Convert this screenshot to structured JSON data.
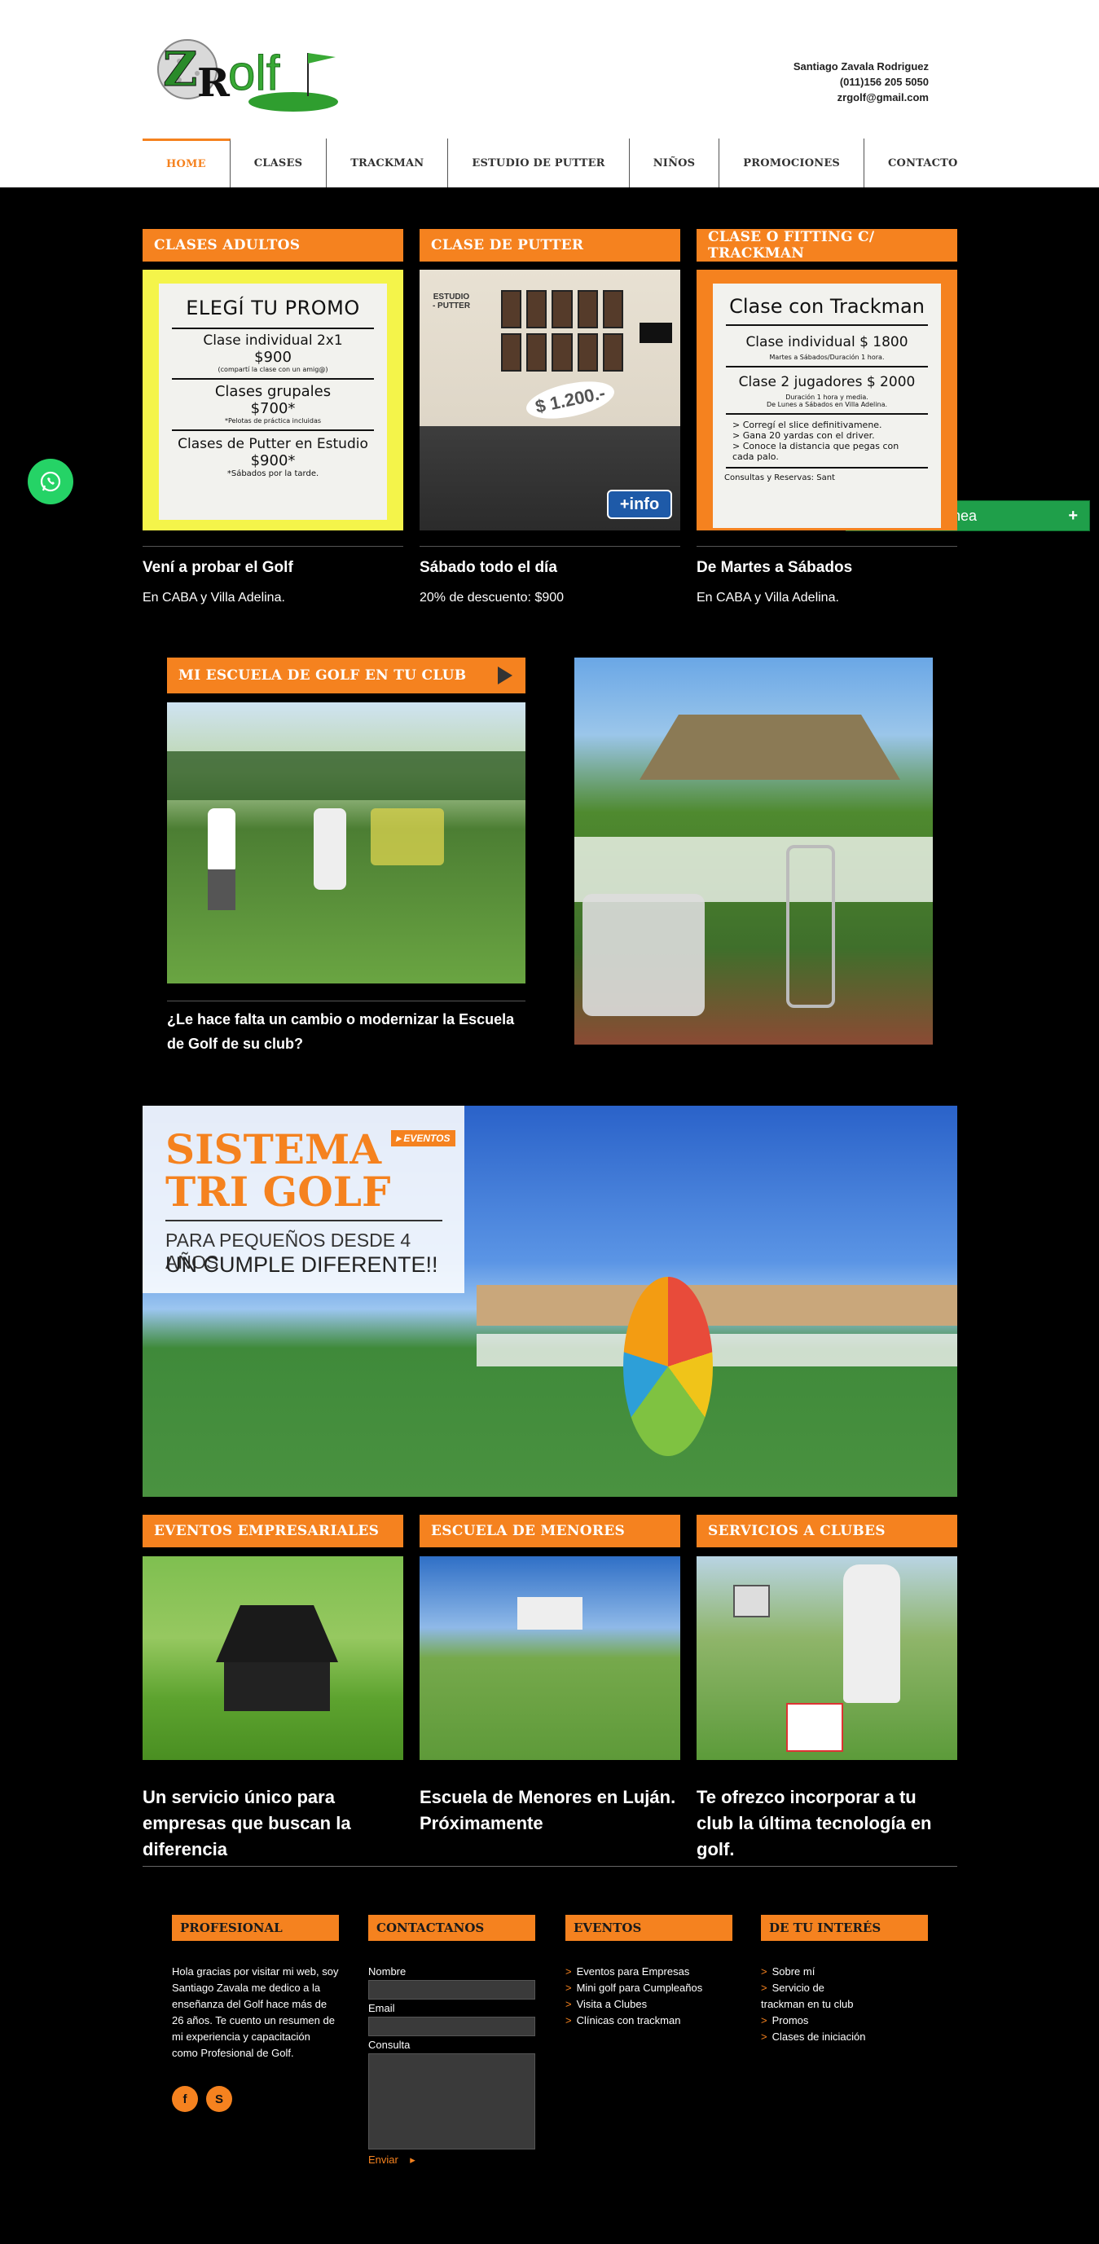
{
  "header": {
    "logo_text": "ZRGolf",
    "contact_name": "Santiago Zavala Rodriguez",
    "contact_phone": "(011)156 205 5050",
    "contact_email": "zrgolf@gmail.com"
  },
  "nav": [
    "HOME",
    "CLASES",
    "TRACKMAN",
    "ESTUDIO DE PUTTER",
    "NIÑOS",
    "PROMOCIONES",
    "CONTACTO"
  ],
  "chat": {
    "label": "ZR Golf - En Línea",
    "toggle": "+"
  },
  "row1": [
    {
      "header": "CLASES ADULTOS",
      "title": "Vení a probar el Golf",
      "sub": "En CABA y Villa Adelina.",
      "promo": {
        "heading": "ELEGÍ TU PROMO",
        "l1": "Clase individual 2x1",
        "l1b": "$900",
        "l1c": "(compartí la clase con un amig@)",
        "l2": "Clases grupales",
        "l2b": "$700*",
        "l2c": "*Pelotas de práctica incluidas",
        "l3": "Clases de Putter en Estudio",
        "l3b": "$900*",
        "l3c": "*Sábados por la tarde."
      }
    },
    {
      "header": "CLASE DE PUTTER",
      "title": "Sábado todo el día",
      "sub": "20% de descuento: $900",
      "img": {
        "price": "$ 1.200.-",
        "sign": "ESTUDIO - PUTTER",
        "info": "+info"
      }
    },
    {
      "header": "CLASE O FITTING C/ TRACKMAN",
      "title": "De Martes a Sábados",
      "sub": "En CABA y Villa Adelina.",
      "promo": {
        "heading": "Clase con Trackman",
        "l1": "Clase individual $ 1800",
        "l1c": "Martes a Sábados/Duración 1 hora.",
        "l2": "Clase 2 jugadores $ 2000",
        "l2c": "Duración 1 hora y media.",
        "l2d": "De Lunes a Sábados en Villa Adelina.",
        "b1": "> Corregí el slice definitivamene.",
        "b2": "> Gana 20 yardas con el driver.",
        "b3": "> Conoce la distancia que pegas con cada palo.",
        "footer": "Consultas y Reservas: Sant"
      }
    }
  ],
  "club_school": {
    "header": "MI ESCUELA DE GOLF EN TU CLUB",
    "text": "¿Le hace falta un cambio o modernizar la Escuela de Golf de su club?"
  },
  "banner": {
    "tag": "EVENTOS",
    "title1": "SISTEMA",
    "title2": "TRI GOLF",
    "sub1": "PARA PEQUEÑOS DESDE 4 AÑOS",
    "sub2": "UN CUMPLE DIFERENTE!!"
  },
  "row2": [
    {
      "header": "EVENTOS EMPRESARIALES",
      "text": "Un servicio único para empresas que buscan la diferencia"
    },
    {
      "header": "ESCUELA DE MENORES",
      "text": "Escuela de Menores en Luján. Próximamente"
    },
    {
      "header": "SERVICIOS A CLUBES",
      "text": "Te ofrezco incorporar a tu club la última tecnología en golf."
    }
  ],
  "footer": {
    "profesional": {
      "title": "PROFESIONAL",
      "text": "Hola gracias por visitar mi web, soy Santiago Zavala me dedico a la enseñanza del Golf hace más de 26 años. Te cuento un resumen de mi experiencia y capacitación como Profesional de Golf."
    },
    "contact": {
      "title": "CONTACTANOS",
      "name_label": "Nombre",
      "email_label": "Email",
      "query_label": "Consulta",
      "send": "Enviar"
    },
    "events": {
      "title": "EVENTOS",
      "links": [
        "Eventos para Empresas",
        "Mini golf para Cumpleaños",
        "Visita a Clubes",
        "Clínicas con trackman"
      ]
    },
    "interest": {
      "title": "DE TU INTERÉS",
      "links": [
        "Sobre mí",
        "Servicio de trackman en tu club",
        "Promos",
        "Clases de iniciación"
      ]
    }
  },
  "colors": {
    "accent": "#f5821f",
    "bg": "#000000",
    "whatsapp": "#25d366",
    "chat": "#1f9f4a"
  }
}
